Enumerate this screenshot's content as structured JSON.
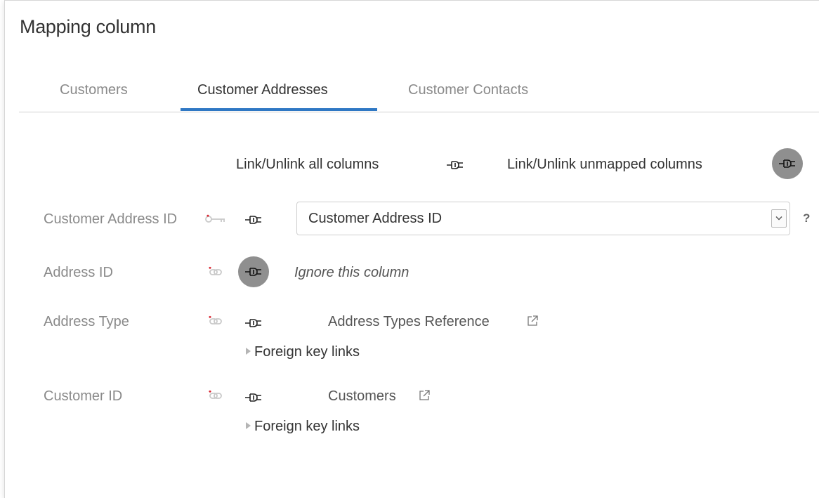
{
  "dialog": {
    "title": "Mapping column"
  },
  "tabs": [
    {
      "label": "Customers",
      "active": false
    },
    {
      "label": "Customer Addresses",
      "active": true
    },
    {
      "label": "Customer Contacts",
      "active": false
    }
  ],
  "toolbar": {
    "link_all_label": "Link/Unlink all columns",
    "link_unmapped_label": "Link/Unlink unmapped columns"
  },
  "rows": [
    {
      "label": "Customer Address ID",
      "key_icon": "primary-key-icon",
      "selected_value": "Customer Address ID",
      "help": "?"
    },
    {
      "label": "Address ID",
      "key_icon": "foreign-key-icon",
      "ignore_text": "Ignore this column"
    },
    {
      "label": "Address Type",
      "key_icon": "foreign-key-icon",
      "reference": "Address Types Reference",
      "fk_toggle": "Foreign key links"
    },
    {
      "label": "Customer ID",
      "key_icon": "foreign-key-icon",
      "reference": "Customers",
      "fk_toggle": "Foreign key links"
    }
  ],
  "colors": {
    "accent": "#2f78c4",
    "plug_active_bg": "#8f8f8f",
    "label_gray": "#8a8a8a",
    "key_red": "#d9232e"
  }
}
